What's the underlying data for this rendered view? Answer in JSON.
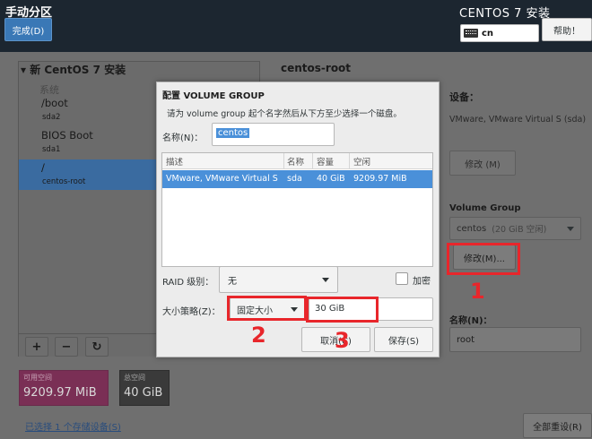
{
  "header": {
    "page_title": "手动分区",
    "done_label": "完成(D)",
    "product_title": "CENTOS 7 安装",
    "keyboard_layout": "cn",
    "help_label": "帮助！"
  },
  "left_panel": {
    "install_title": "▾ 新 CentOS 7 安装",
    "group_label": "系统",
    "mounts": [
      {
        "name": "/boot",
        "device": "sda2"
      },
      {
        "name": "BIOS Boot",
        "device": "sda1"
      },
      {
        "name": "/",
        "device": "centos-root",
        "selected": true
      }
    ],
    "buttons": {
      "add": "+",
      "remove": "−",
      "refresh": "↻"
    },
    "available_label": "可用空间",
    "available_value": "9209.97 MiB",
    "total_label": "总空间",
    "total_value": "40 GiB",
    "storage_link": "已选择 1 个存储设备(S)"
  },
  "right_panel": {
    "title": "centos-root",
    "device_heading": "设备：",
    "device_value": "VMware, VMware Virtual S (sda)",
    "device_modify_label": "修改 (M)",
    "vg_heading": "Volume Group",
    "vg_name": "centos",
    "vg_free": "(20 GiB 空闲)",
    "vg_modify_label": "修改(M)...",
    "name_heading": "名称(N)：",
    "name_value": "root",
    "reset_label": "全部重设(R)"
  },
  "dialog": {
    "title": "配置 VOLUME GROUP",
    "description": "请为 volume group 起个名字然后从下方至少选择一个磁盘。",
    "name_label": "名称(N)：",
    "name_value": "centos",
    "table": {
      "headers": [
        "描述",
        "名称",
        "容量",
        "空闲"
      ],
      "rows": [
        [
          "VMware, VMware Virtual S",
          "sda",
          "40 GiB",
          "9209.97 MiB"
        ]
      ]
    },
    "raid_label": "RAID 级别：",
    "raid_value": "无",
    "encrypt_label": "加密",
    "size_policy_label": "大小策略(Z)：",
    "size_policy_value": "固定大小",
    "size_value": "30 GiB",
    "cancel_label": "取消(C)",
    "save_label": "保存(S)"
  },
  "annotations": {
    "step1": "1",
    "step2": "2",
    "step3": "3",
    "color": "#e8262b"
  }
}
